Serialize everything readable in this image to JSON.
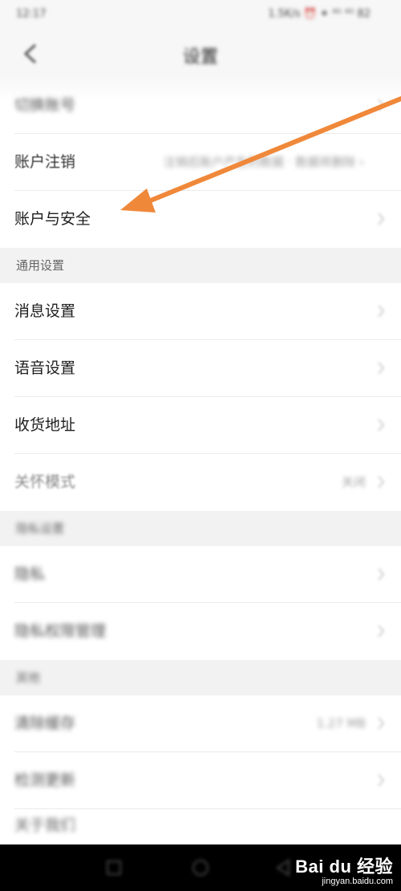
{
  "status_bar": {
    "time": "12:17",
    "right": "1.5K/s ⏰ ✦ ⁴ᴳ ⁴ᴳ 82"
  },
  "header": {
    "title": "设置"
  },
  "rows_top": [
    {
      "label": "切换账号",
      "value": ""
    },
    {
      "label": "账户注销",
      "value": "注销后账户产生的数据 · 数据将删除 ›"
    },
    {
      "label": "账户与安全",
      "value": ""
    }
  ],
  "section_general": {
    "label": "通用设置"
  },
  "rows_general": [
    {
      "label": "消息设置"
    },
    {
      "label": "语音设置"
    },
    {
      "label": "收货地址"
    },
    {
      "label": "关怀模式",
      "value": "关闭"
    }
  ],
  "section_privacy": {
    "label": "隐私设置"
  },
  "rows_privacy": [
    {
      "label": "隐私"
    },
    {
      "label": "隐私权限管理"
    }
  ],
  "section_other": {
    "label": "其他"
  },
  "rows_other": [
    {
      "label": "清除缓存",
      "value": "1.27 MB"
    },
    {
      "label": "检测更新"
    },
    {
      "label": "关于我们"
    }
  ],
  "watermark": {
    "logo": "Bai du 经验",
    "url": "jingyan.baidu.com"
  },
  "colors": {
    "arrow": "#f0883a",
    "background": "#f3f3f3",
    "row": "#ffffff"
  },
  "icons": {
    "back": "chevron-left-icon",
    "row": "chevron-right-icon",
    "arrow": "arrow-annotation"
  }
}
